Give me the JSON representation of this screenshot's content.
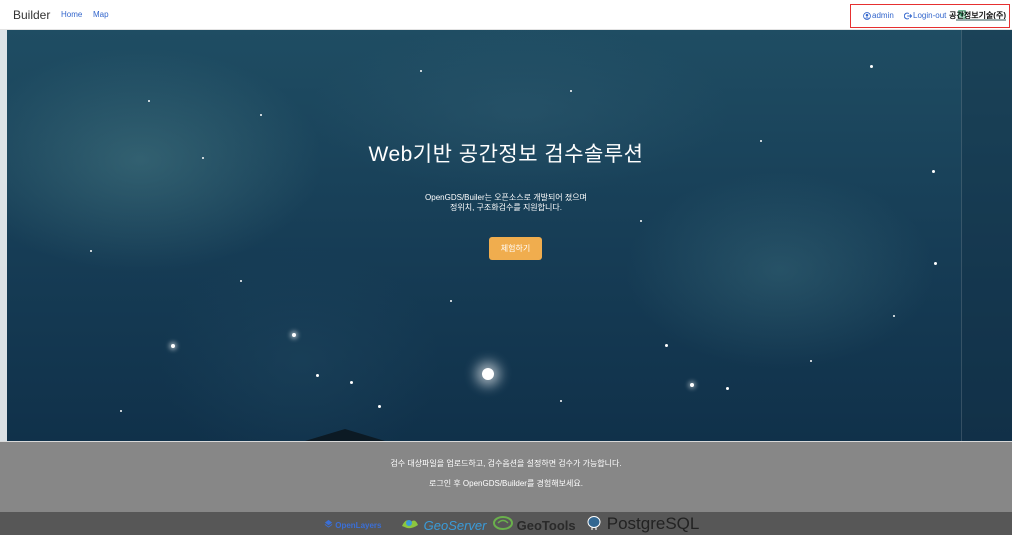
{
  "navbar": {
    "brand": "Builder",
    "links": [
      "Home",
      "Map"
    ],
    "user": "admin",
    "logout": "Login-out",
    "org_logo": "공간정보기술(주)"
  },
  "hero": {
    "title": "Web기반 공간정보 검수솔루션",
    "desc_line1": "OpenGDS/Builer는 오픈소스로 개발되어 졌으며",
    "desc_line2": "정위치, 구조화검수를 지원합니다.",
    "cta_label": "체험하기"
  },
  "info": {
    "line1": "검수 대상파일을 업로드하고, 검수옵션을 설정하면 검수가 가능합니다.",
    "line2": "로그인 후 OpenGDS/Builder를 경험해보세요."
  },
  "partners": [
    {
      "name": "OpenLayers",
      "icon": "openlayers-icon"
    },
    {
      "name": "GeoServer",
      "icon": "geoserver-icon"
    },
    {
      "name": "GeoTools",
      "icon": "geotools-icon"
    },
    {
      "name": "PostgreSQL",
      "icon": "postgresql-icon"
    }
  ],
  "colors": {
    "accent": "#f0ad4e",
    "link": "#3366cc",
    "hero_bg": "#163c55",
    "info_bg": "#878787",
    "partner_bg": "#575757",
    "highlight_border": "#e63030"
  }
}
